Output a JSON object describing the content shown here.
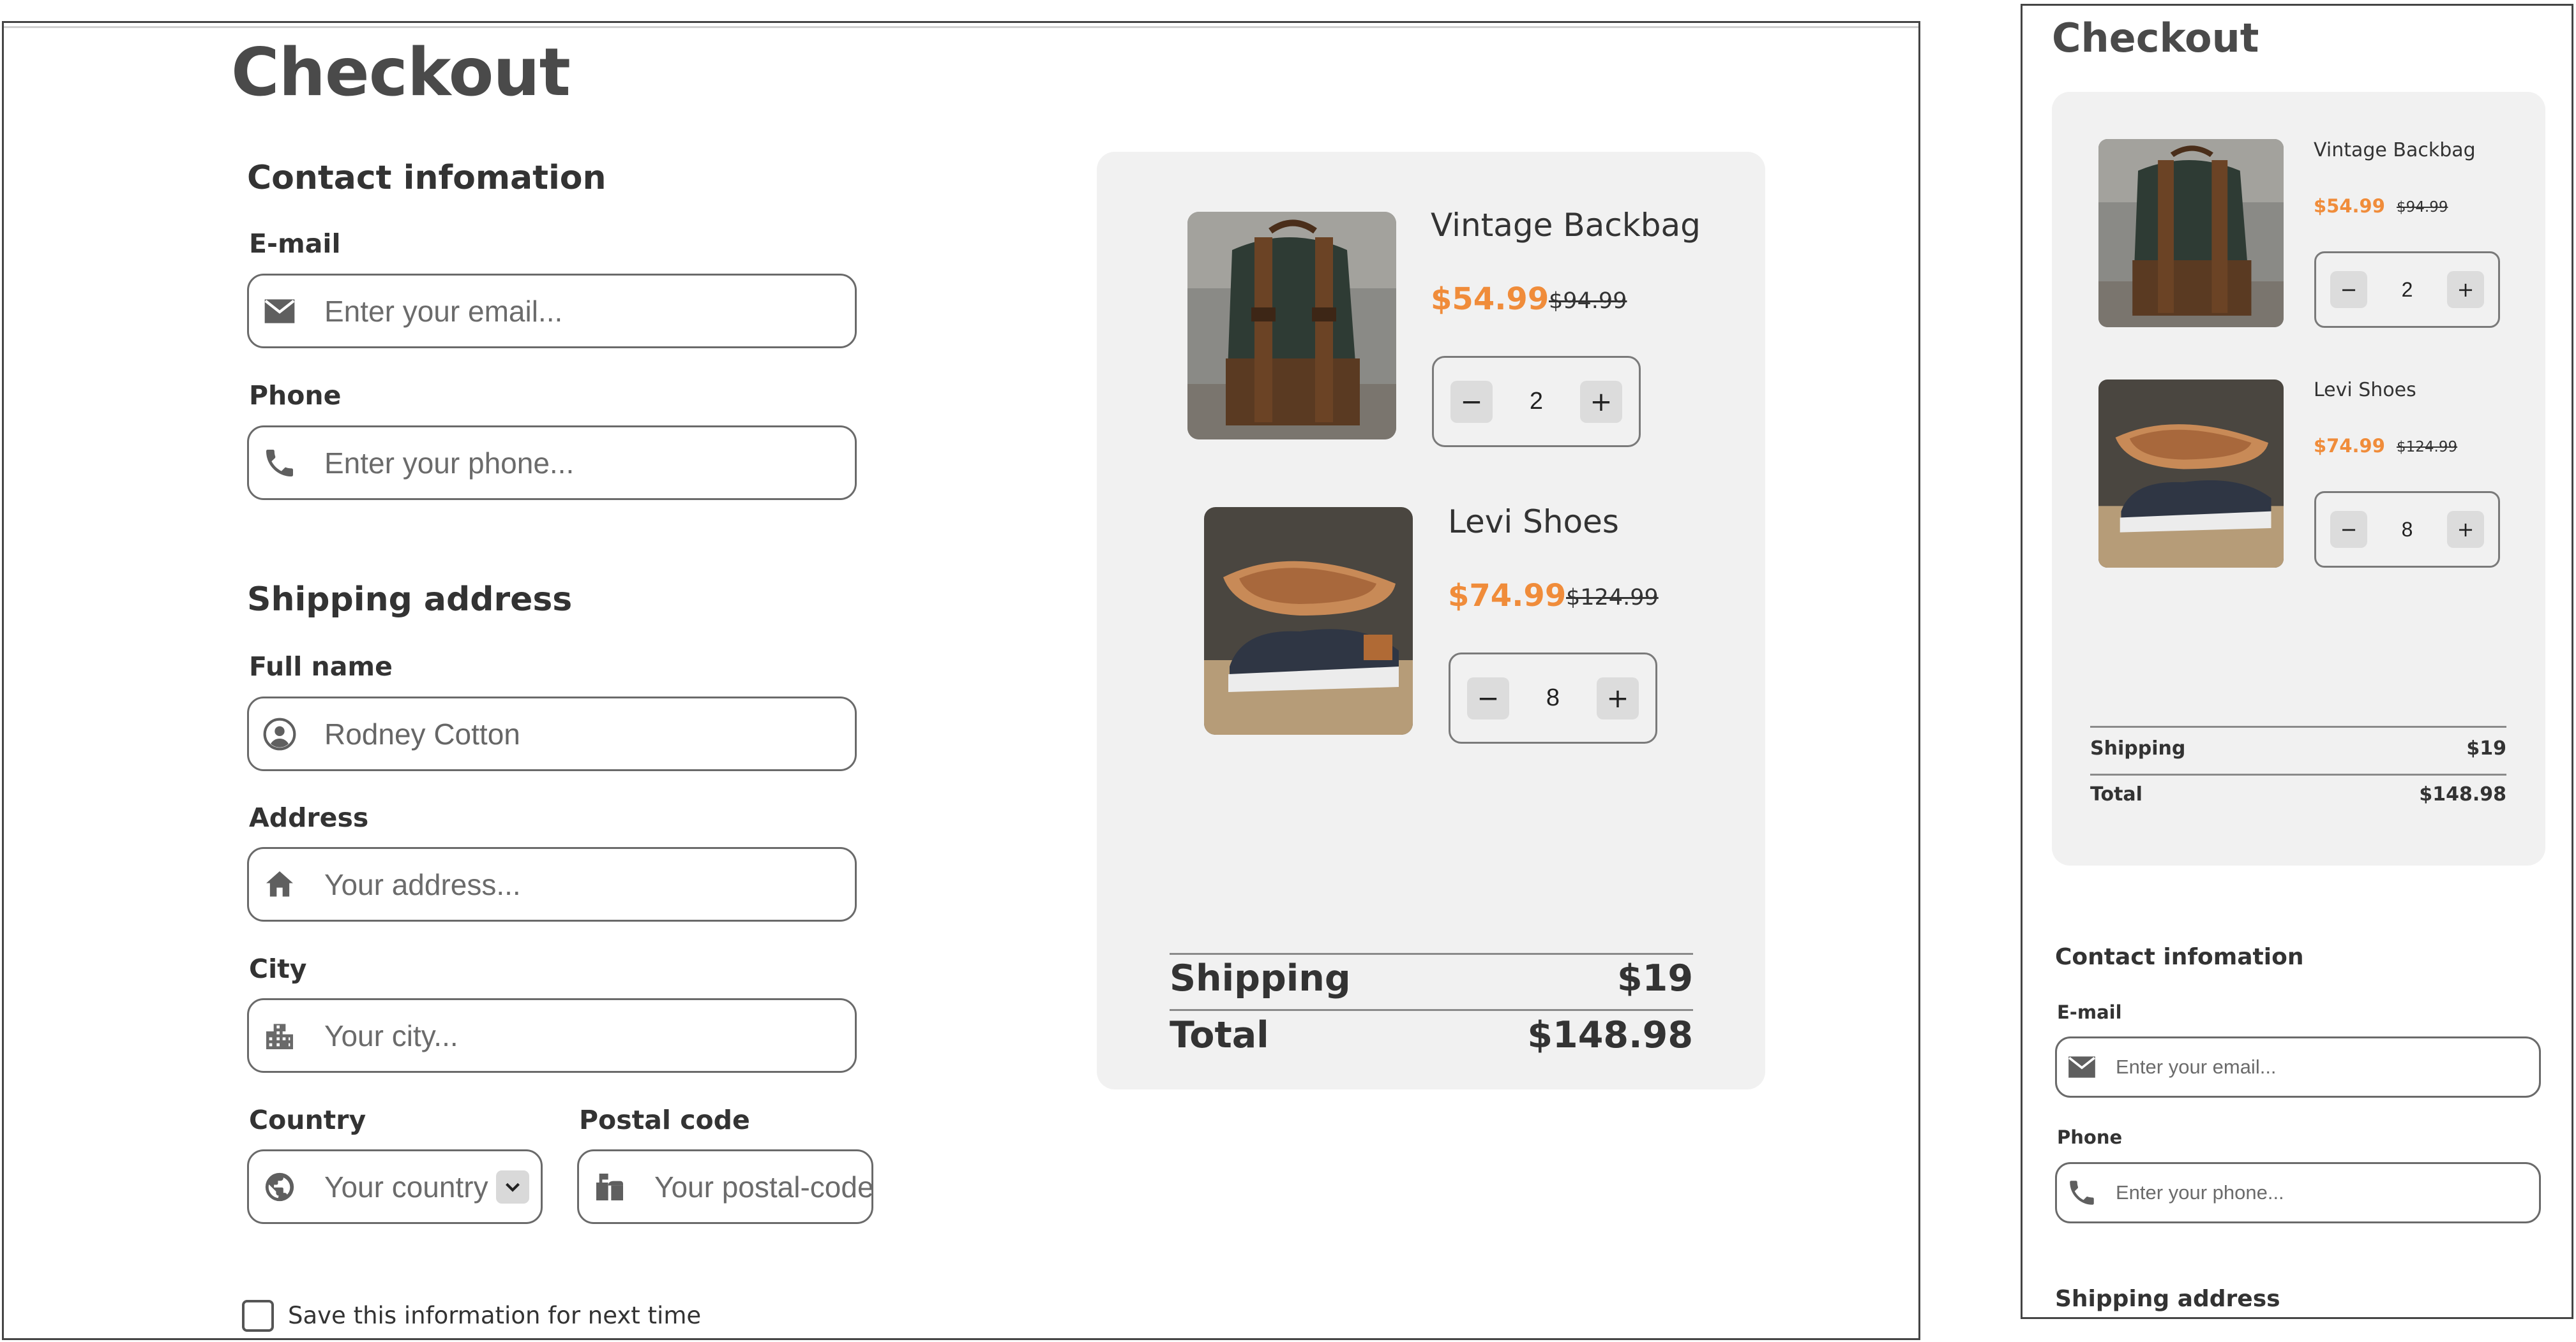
{
  "desktop": {
    "title": "Checkout",
    "contact": {
      "heading": "Contact infomation",
      "email_label": "E-mail",
      "email_placeholder": "Enter your email...",
      "phone_label": "Phone",
      "phone_placeholder": "Enter your phone..."
    },
    "shipping": {
      "heading": "Shipping address",
      "fullname_label": "Full name",
      "fullname_value": "Rodney Cotton",
      "address_label": "Address",
      "address_placeholder": "Your address...",
      "city_label": "City",
      "city_placeholder": "Your city...",
      "country_label": "Country",
      "country_placeholder": "Your country",
      "postal_label": "Postal code",
      "postal_placeholder": "Your postal-code..."
    },
    "save_label": "Save this information for next time"
  },
  "mobile": {
    "title": "Checkout",
    "contact": {
      "heading": "Contact infomation",
      "email_label": "E-mail",
      "email_placeholder": "Enter your email...",
      "phone_label": "Phone",
      "phone_placeholder": "Enter your phone..."
    },
    "shipping_heading": "Shipping address"
  },
  "cart": {
    "items": [
      {
        "name": "Vintage Backbag",
        "price": "$54.99",
        "old_price": "$94.99",
        "qty": "2"
      },
      {
        "name": "Levi Shoes",
        "price": "$74.99",
        "old_price": "$124.99",
        "qty": "8"
      }
    ],
    "summary": {
      "shipping_label": "Shipping",
      "shipping_value": "$19",
      "total_label": "Total",
      "total_value": "$148.98"
    },
    "minus": "−",
    "plus": "+"
  },
  "colors": {
    "accent": "#f08c3a",
    "card_bg": "#f1f1f1",
    "border": "#6a6a6a"
  },
  "icons": [
    "mail-icon",
    "phone-icon",
    "user-circle-icon",
    "home-icon",
    "city-icon",
    "globe-icon",
    "chevron-down-icon",
    "mailbox-icon",
    "backpack-image",
    "shoe-image"
  ]
}
